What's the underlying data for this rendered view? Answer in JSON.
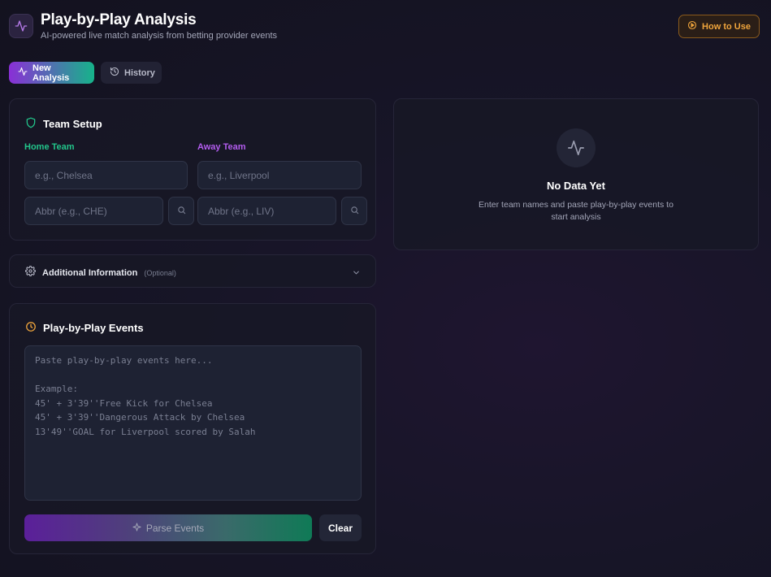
{
  "header": {
    "title": "Play-by-Play Analysis",
    "subtitle": "AI-powered live match analysis from betting provider events",
    "how_to_label": "How to Use"
  },
  "tabs": [
    {
      "label": "New Analysis",
      "active": true
    },
    {
      "label": "History",
      "active": false
    }
  ],
  "team_setup": {
    "title": "Team Setup",
    "home_label": "Home Team",
    "away_label": "Away Team",
    "home_name_placeholder": "e.g., Chelsea",
    "away_name_placeholder": "e.g., Liverpool",
    "home_abbr_placeholder": "Abbr (e.g., CHE)",
    "away_abbr_placeholder": "Abbr (e.g., LIV)",
    "home_name_value": "",
    "away_name_value": "",
    "home_abbr_value": "",
    "away_abbr_value": ""
  },
  "additional_info": {
    "title": "Additional Information",
    "optional_tag": "(Optional)"
  },
  "events": {
    "title": "Play-by-Play Events",
    "placeholder": "Paste play-by-play events here...\n\nExample:\n45' + 3'39''Free Kick for Chelsea\n45' + 3'39''Dangerous Attack by Chelsea\n13'49''GOAL for Liverpool scored by Salah",
    "value": "",
    "parse_label": "Parse Events",
    "clear_label": "Clear"
  },
  "no_data": {
    "title": "No Data Yet",
    "line1": "Enter team names and paste play-by-play events to",
    "line2": "start analysis"
  },
  "colors": {
    "home_accent": "#22c58b",
    "away_accent": "#b45df0",
    "warning_accent": "#f0a53c",
    "brand_gradient_start": "#8a2fd6",
    "brand_gradient_end": "#16b38a"
  },
  "icons": {
    "logo": "activity-icon",
    "how_to": "play-circle-icon",
    "new_analysis": "activity-icon",
    "history": "history-icon",
    "team_setup": "shield-icon",
    "search": "search-icon",
    "additional_info": "gear-icon",
    "expand": "chevron-down-icon",
    "events": "clock-icon",
    "parse": "sparkle-icon",
    "no_data": "activity-icon"
  }
}
